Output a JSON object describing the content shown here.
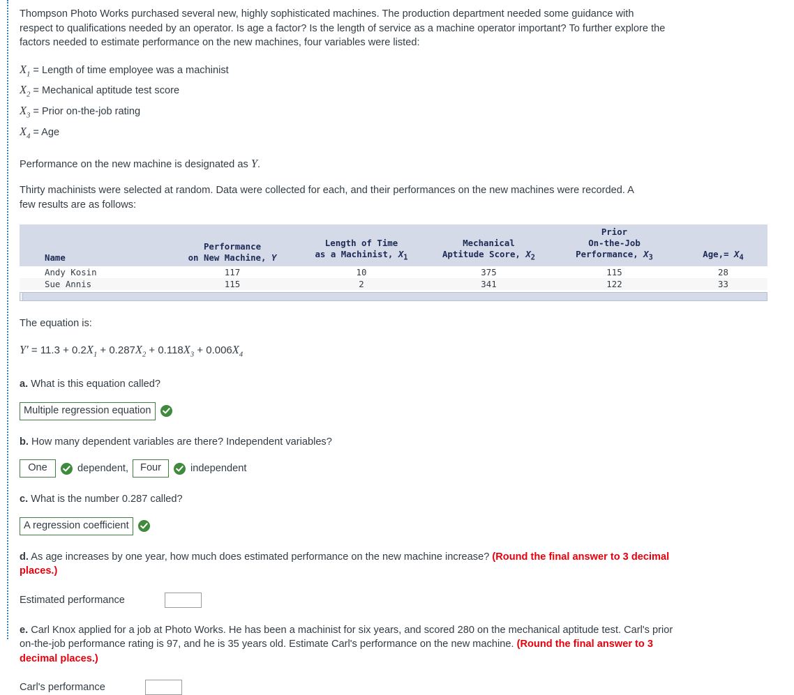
{
  "intro": {
    "paragraph": "Thompson Photo Works purchased several new, highly sophisticated machines. The production department needed some guidance with respect to qualifications needed by an operator. Is age a factor? Is the length of service as a machine operator important? To further explore the factors needed to estimate performance on the new machines, four variables were listed:"
  },
  "variables": [
    {
      "symbol": "X",
      "sub": "1",
      "definition": "= Length of time employee was a machinist"
    },
    {
      "symbol": "X",
      "sub": "2",
      "definition": "= Mechanical aptitude test score"
    },
    {
      "symbol": "X",
      "sub": "3",
      "definition": "= Prior on-the-job rating"
    },
    {
      "symbol": "X",
      "sub": "4",
      "definition": "= Age"
    }
  ],
  "performance_note": {
    "text_before": "Performance on the new machine is designated as",
    "symbol": "Y",
    "text_after": "."
  },
  "sample_note": "Thirty machinists were selected at random. Data were collected for each, and their performances on the new machines were recorded. A few results are as follows:",
  "table": {
    "headers": [
      {
        "line1": "",
        "line2": "",
        "line3": "Name"
      },
      {
        "line1": "",
        "line2": "Performance",
        "line3": "on New Machine, Y"
      },
      {
        "line1": "",
        "line2": "Length of Time",
        "line3": "as a Machinist, X1"
      },
      {
        "line1": "",
        "line2": "Mechanical",
        "line3": "Aptitude Score, X2"
      },
      {
        "line1": "Prior",
        "line2": "On-the-Job",
        "line3": "Performance, X3"
      },
      {
        "line1": "",
        "line2": "",
        "line3": "Age, = X4"
      }
    ],
    "rows": [
      {
        "name": "Andy Kosin",
        "performance": "117",
        "length_of_time": "10",
        "aptitude": "375",
        "prior_rating": "115",
        "age": "28"
      },
      {
        "name": "Sue Annis",
        "performance": "115",
        "length_of_time": "2",
        "aptitude": "341",
        "prior_rating": "122",
        "age": "33"
      }
    ]
  },
  "equation": {
    "label": "The equation is:",
    "lhs": "Y'",
    "eq": "=",
    "intercept": "11.3",
    "terms": [
      {
        "op": "+",
        "coef": "0.2",
        "var": "X",
        "sub": "1"
      },
      {
        "op": "+",
        "coef": "0.287",
        "var": "X",
        "sub": "2"
      },
      {
        "op": "+",
        "coef": "0.118",
        "var": "X",
        "sub": "3"
      },
      {
        "op": "+",
        "coef": "0.006",
        "var": "X",
        "sub": "4"
      }
    ]
  },
  "questions": {
    "a": {
      "label": "a.",
      "text": "What is this equation called?",
      "answer": "Multiple regression equation",
      "correct": true
    },
    "b": {
      "label": "b.",
      "text": "How many dependent variables are there? Independent variables?",
      "answer1": "One",
      "mid_label": "dependent,",
      "answer2": "Four",
      "end_label": "independent",
      "correct1": true,
      "correct2": true
    },
    "c": {
      "label": "c.",
      "text": "What is the number 0.287 called?",
      "answer": "A regression coefficient",
      "correct": true
    },
    "d": {
      "label": "d.",
      "text": "As age increases by one year, how much does estimated performance on the new machine increase?",
      "round_note": "(Round the final answer to 3 decimal places.)",
      "input_label": "Estimated performance",
      "input_value": "",
      "input_placeholder": ""
    },
    "e": {
      "label": "e.",
      "text": "Carl Knox applied for a job at Photo Works. He has been a machinist for six years, and scored 280 on the mechanical aptitude test. Carl's prior on-the-job performance rating is 97, and he is 35 years old. Estimate Carl's performance on the new machine.",
      "round_note": "(Round the final answer to 3 decimal places.)",
      "input_label": "Carl's performance",
      "input_value": "",
      "input_placeholder": ""
    }
  },
  "colors": {
    "text": "#333c44",
    "red_note": "#e8000d",
    "check_green": "#3f8a3d",
    "answer_border_green": "#3f7f41",
    "table_header_bg": "#d4dae7",
    "table_header_text": "#1c2a55",
    "rail_blue": "#2f7fc0"
  }
}
